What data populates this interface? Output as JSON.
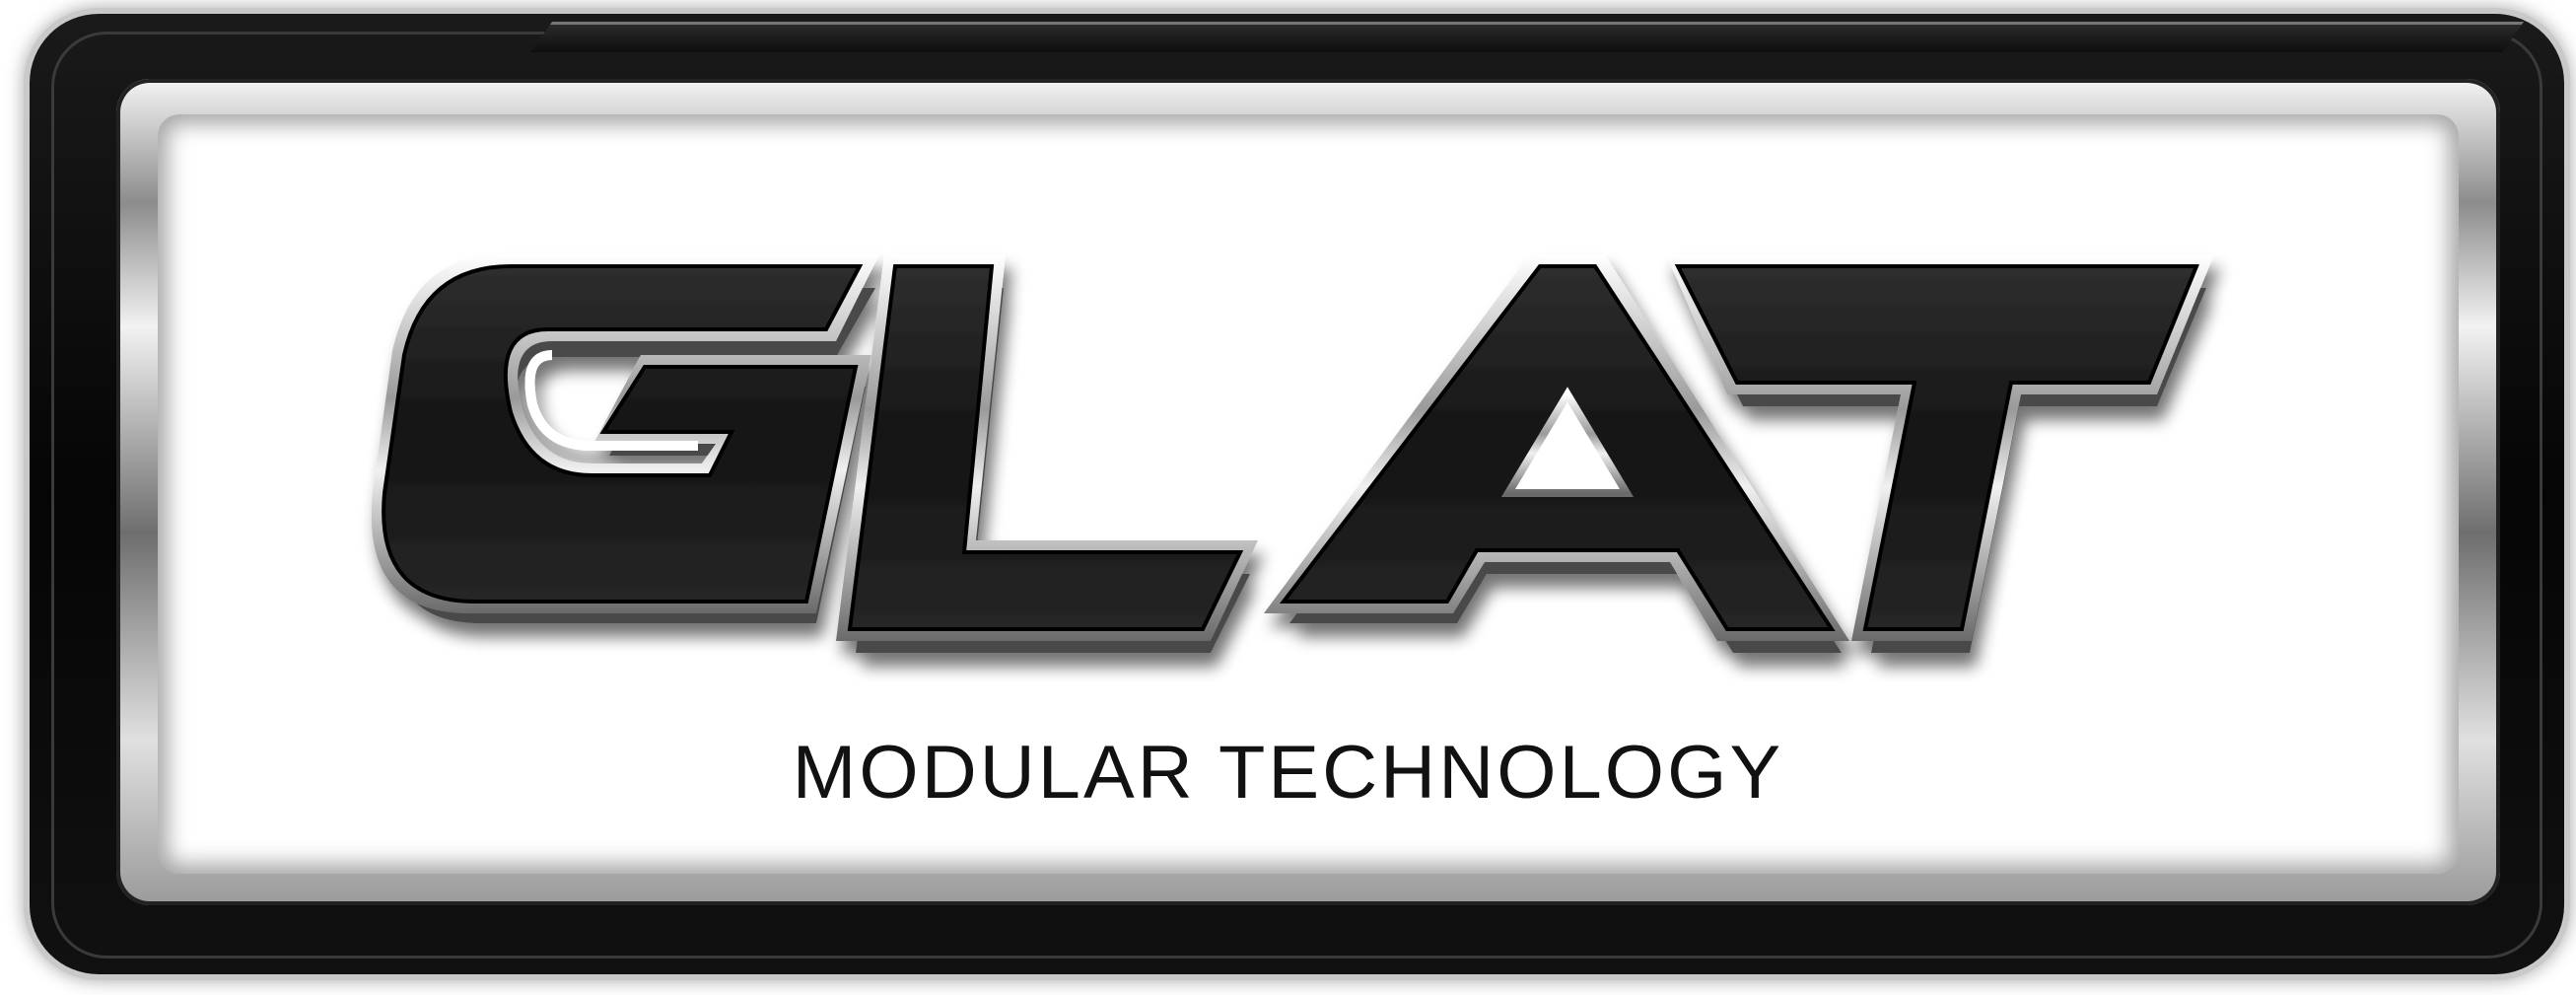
{
  "logo": {
    "wordmark": "GLAT",
    "tagline": "MODULAR TECHNOLOGY"
  },
  "colors": {
    "frame_dark": "#0a0a0a",
    "chrome_light": "#f2f2f2",
    "chrome_mid": "#8c8c8c",
    "letter_fill": "#1c1c1c",
    "letter_outline": "#d8d8d8",
    "background": "#ffffff"
  }
}
